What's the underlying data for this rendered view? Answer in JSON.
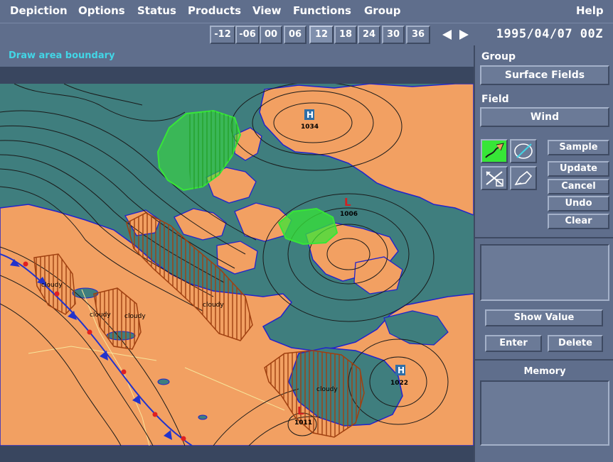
{
  "menu": {
    "items": [
      "Depiction",
      "Options",
      "Status",
      "Products",
      "View",
      "Functions",
      "Group"
    ],
    "help": "Help"
  },
  "timebar": {
    "steps": [
      "-12",
      "-06",
      "00",
      "06",
      "12",
      "18",
      "24",
      "30",
      "36"
    ],
    "selected": "12",
    "datetime": "1995/04/07 00Z"
  },
  "map": {
    "instruction": "Draw area boundary",
    "pressure_centers": [
      {
        "type": "H",
        "value": "1034"
      },
      {
        "type": "L",
        "value": "1006"
      },
      {
        "type": "H",
        "value": "1022"
      },
      {
        "type": "L",
        "value": "1011"
      }
    ],
    "area_labels": [
      "cloudy",
      "cloudy",
      "cloudy",
      "cloudy",
      "flurries",
      "cloudy"
    ],
    "colors": {
      "land": "#f2a062",
      "water": "#3f7e7e",
      "isobar": "#1a1a1a",
      "coastline": "#2222cc",
      "front": "#e02020",
      "precip_area": "#37e637",
      "cloud_area": "#a04010",
      "high_marker": "#2d6ea8",
      "low_marker": "#d42020"
    }
  },
  "panel": {
    "group_label": "Group",
    "group_value": "Surface Fields",
    "field_label": "Field",
    "field_value": "Wind",
    "buttons": {
      "sample": "Sample",
      "update": "Update",
      "cancel": "Cancel",
      "undo": "Undo",
      "clear": "Clear",
      "show_value": "Show Value",
      "enter": "Enter",
      "delete": "Delete"
    },
    "memory_label": "Memory",
    "tools": [
      "draw-line-icon",
      "draw-area-icon",
      "move-icon",
      "modify-icon"
    ],
    "active_tool": "draw-line-icon"
  }
}
